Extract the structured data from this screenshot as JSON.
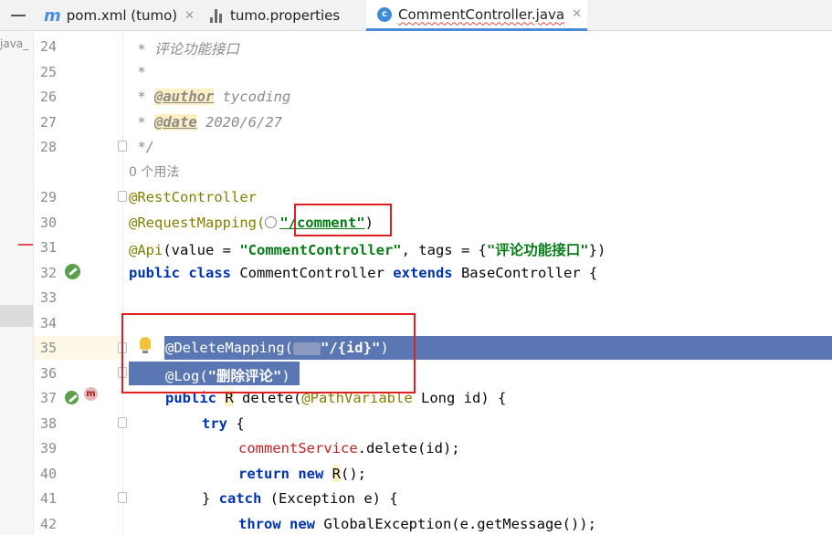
{
  "tabs": [
    {
      "label": "pom.xml (tumo)",
      "icon": "maven-icon"
    },
    {
      "label": "tumo.properties",
      "icon": "properties-icon"
    },
    {
      "label": "CommentController.java",
      "icon": "java-class-icon",
      "active": true
    }
  ],
  "tab_close_glyph": "✕",
  "left_strip": {
    "path_text": "java_"
  },
  "usage_hint": "0 个用法",
  "lines": {
    "l24": {
      "num": "24",
      "text": " * 评论功能接口"
    },
    "l25": {
      "num": "25",
      "text": " *"
    },
    "l26": {
      "num": "26",
      "star": " * ",
      "tag": "@author",
      "rest": " tycoding"
    },
    "l27": {
      "num": "27",
      "star": " * ",
      "tag": "@date",
      "rest": " 2020/6/27"
    },
    "l28": {
      "num": "28",
      "text": " */"
    },
    "l29": {
      "num": "29",
      "text": "@RestController"
    },
    "l30": {
      "num": "30",
      "ann": "@RequestMapping(",
      "str": "\"/comment\"",
      "close": ")"
    },
    "l31": {
      "num": "31",
      "ann": "@Api",
      "p1": "(value = ",
      "s1": "\"CommentController\"",
      "p2": ", tags = {",
      "s2": "\"评论功能接口\"",
      "p3": "})"
    },
    "l32": {
      "num": "32",
      "k1": "public class",
      "name": " CommentController ",
      "k2": "extends",
      "rest": " BaseController {"
    },
    "l33": {
      "num": "33"
    },
    "l34": {
      "num": "34"
    },
    "l35": {
      "num": "35",
      "ann": "@DeleteMapping(",
      "str": "\"/{id}\"",
      "close": ")"
    },
    "l36": {
      "num": "36",
      "ann": "@Log(",
      "str": "\"删除评论\"",
      "close": ")"
    },
    "l37": {
      "num": "37",
      "k1": "public",
      "type": "R",
      "mid": " delete(",
      "ann": "@PathVariable",
      "rest": " Long id) {"
    },
    "l38": {
      "num": "38",
      "k1": "try",
      "rest": " {"
    },
    "l39": {
      "num": "39",
      "field": "commentService",
      "rest": ".delete(id);"
    },
    "l40": {
      "num": "40",
      "k1": "return new",
      "type": "R",
      "rest": "();"
    },
    "l41": {
      "num": "41",
      "p1": "} ",
      "k1": "catch",
      "rest": " (Exception e) {"
    },
    "l42": {
      "num": "42",
      "k1": "throw new",
      "rest": " GlobalException(e.getMessage());"
    }
  },
  "colors": {
    "keyword": "#0033b3",
    "annotation": "#808000",
    "string": "#067d17",
    "comment": "#8c8c8c",
    "field": "#c71e1e",
    "selection": "#5b77b3",
    "annotation_box": "#e02020"
  }
}
